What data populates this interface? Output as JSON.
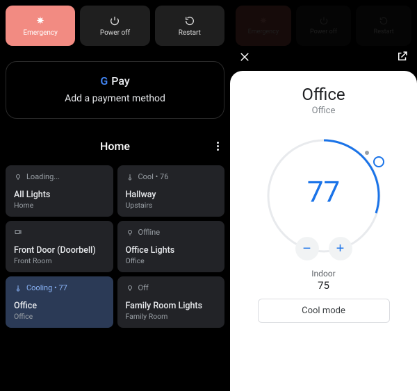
{
  "power": {
    "emergency": "Emergency",
    "poweroff": "Power off",
    "restart": "Restart"
  },
  "pay": {
    "brand": "Pay",
    "sub": "Add a payment method"
  },
  "home": {
    "title": "Home"
  },
  "tiles": [
    {
      "status": "Loading...",
      "name": "All Lights",
      "room": "Home",
      "icon": "bulb"
    },
    {
      "status": "Cool • 76",
      "name": "Hallway",
      "room": "Upstairs",
      "icon": "thermo"
    },
    {
      "status": "",
      "name": "Front Door (Doorbell)",
      "room": "Front Room",
      "icon": "camera"
    },
    {
      "status": "Offline",
      "name": "Office Lights",
      "room": "Office",
      "icon": "bulb"
    },
    {
      "status": "Cooling • 77",
      "name": "Office",
      "room": "Office",
      "icon": "thermo",
      "highlight": true
    },
    {
      "status": "Off",
      "name": "Family Room Lights",
      "room": "Family Room",
      "icon": "bulb"
    }
  ],
  "sheet": {
    "title": "Office",
    "sub": "Office",
    "temp": "77",
    "indoor_label": "Indoor",
    "indoor_val": "75",
    "mode": "Cool mode"
  }
}
